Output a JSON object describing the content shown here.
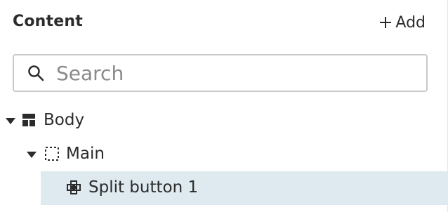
{
  "panel": {
    "title": "Content",
    "add_label": "Add"
  },
  "search": {
    "placeholder": "Search"
  },
  "tree": {
    "items": [
      {
        "label": "Body",
        "icon": "layout-icon",
        "expanded": true,
        "selected": false
      },
      {
        "label": "Main",
        "icon": "dashed-container-icon",
        "expanded": true,
        "selected": false
      },
      {
        "label": "Split button 1",
        "icon": "split-button-icon",
        "expanded": false,
        "selected": true
      }
    ]
  },
  "colors": {
    "selected_row_bg": "#deeaf0",
    "text": "#2b2b2b",
    "placeholder": "#8a8a8a",
    "search_border": "#c9c9c9"
  }
}
